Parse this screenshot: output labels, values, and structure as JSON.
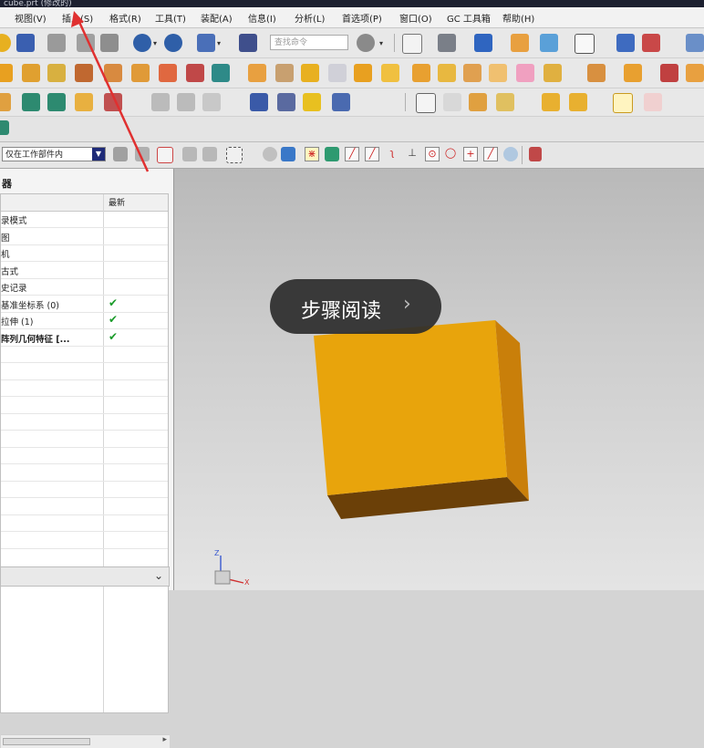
{
  "window": {
    "title": "cube.prt (修改的)"
  },
  "menu": {
    "items": [
      {
        "label": "视图(V)"
      },
      {
        "label": "插入(S)"
      },
      {
        "label": "格式(R)"
      },
      {
        "label": "工具(T)"
      },
      {
        "label": "装配(A)"
      },
      {
        "label": "信息(I)"
      },
      {
        "label": "分析(L)"
      },
      {
        "label": "首选项(P)"
      },
      {
        "label": "窗口(O)"
      },
      {
        "label": "GC 工具箱"
      },
      {
        "label": "帮助(H)"
      }
    ]
  },
  "toolbar": {
    "search_placeholder": "查找命令"
  },
  "selection": {
    "filter_value": "仅在工作部件内"
  },
  "navigator": {
    "title": "器",
    "column_latest": "最新",
    "rows": [
      {
        "label": "录模式",
        "status": ""
      },
      {
        "label": "图",
        "status": ""
      },
      {
        "label": "机",
        "status": ""
      },
      {
        "label": "古式",
        "status": ""
      },
      {
        "label": "史记录",
        "status": ""
      },
      {
        "label": "基准坐标系 (0)",
        "status": "✔"
      },
      {
        "label": "拉伸 (1)",
        "status": "✔"
      },
      {
        "label": "阵列几何特征 [...",
        "status": "✔"
      },
      {
        "label": "",
        "status": ""
      },
      {
        "label": "",
        "status": ""
      },
      {
        "label": "",
        "status": ""
      },
      {
        "label": "",
        "status": ""
      },
      {
        "label": "",
        "status": ""
      },
      {
        "label": "",
        "status": ""
      },
      {
        "label": "",
        "status": ""
      },
      {
        "label": "",
        "status": ""
      },
      {
        "label": "",
        "status": ""
      },
      {
        "label": "",
        "status": ""
      },
      {
        "label": "",
        "status": ""
      },
      {
        "label": "",
        "status": ""
      }
    ]
  },
  "overlay": {
    "text": "步骤阅读",
    "chevron": "›"
  },
  "axes": {
    "z": "Z",
    "x": "X"
  },
  "colors": {
    "cube_front": "#e8a40c",
    "cube_side": "#c97f0a",
    "cube_bottom": "#6b4008",
    "annotation_arrow": "#e03030",
    "check": "#1a9b2a"
  }
}
